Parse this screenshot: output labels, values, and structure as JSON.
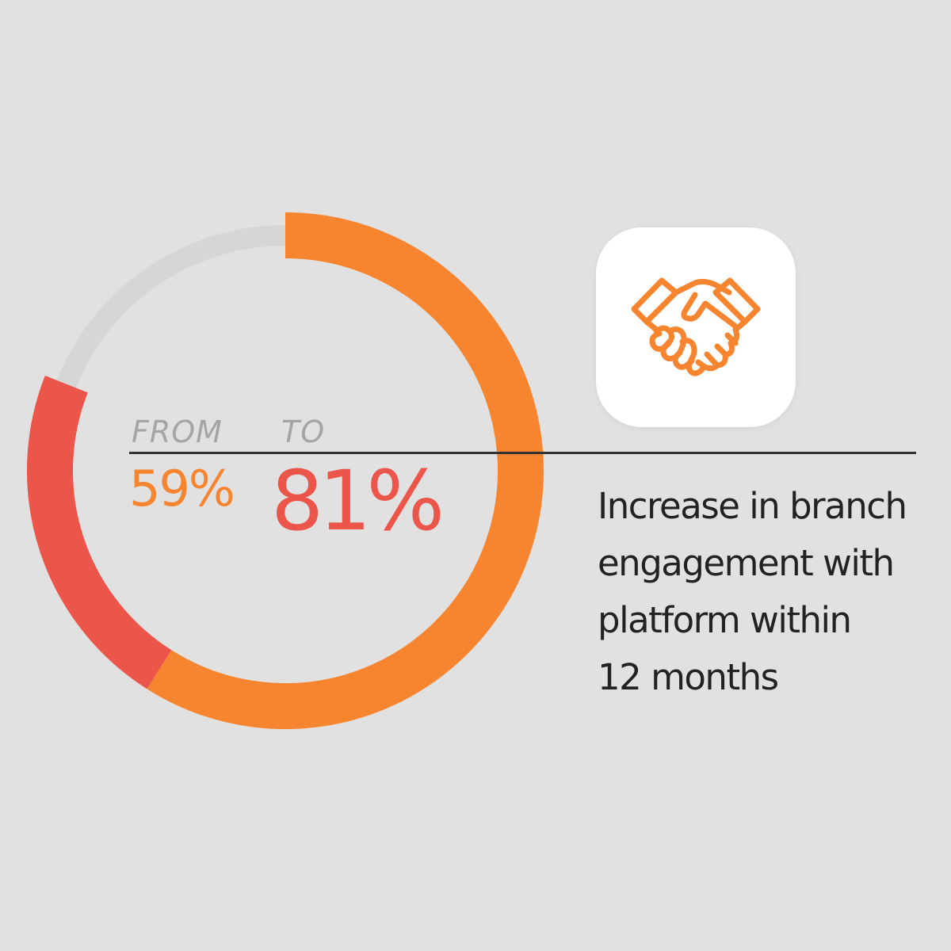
{
  "chart_data": {
    "type": "donut",
    "from": {
      "label": "FROM",
      "value": 59,
      "display": "59%"
    },
    "to": {
      "label": "TO",
      "value": 81,
      "display": "81%"
    },
    "max": 100
  },
  "caption_lines": [
    "Increase in branch",
    "engagement with",
    "platform within",
    "12 months"
  ],
  "icon": "handshake-icon",
  "colors": {
    "background": "#e1e1e1",
    "track": "#d6d6d6",
    "orange": "#f7842e",
    "red": "#ec5549",
    "label_grey": "#a5a5a5",
    "text": "#222222",
    "divider": "#333333"
  }
}
